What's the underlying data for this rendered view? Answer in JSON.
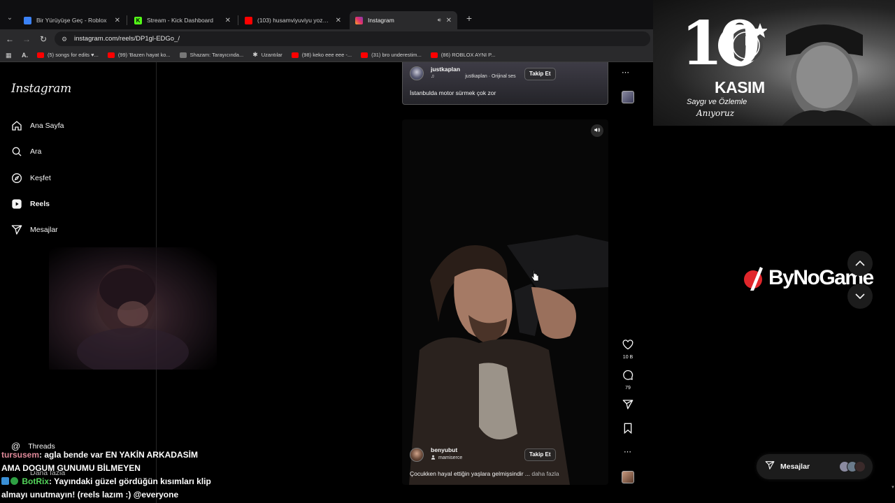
{
  "browser": {
    "tabs": [
      {
        "title": "Bir Yürüyüşe Geç - Roblox",
        "favicon_color": "#3b82f6",
        "active": false
      },
      {
        "title": "Stream - Kick Dashboard",
        "favicon_color": "#53fc18",
        "active": false
      },
      {
        "title": "(103) husamviyuviyu yozgat - Y",
        "favicon_color": "#ff0000",
        "active": false
      },
      {
        "title": "Instagram",
        "favicon_color": "#e1306c",
        "active": true
      }
    ],
    "url": "instagram.com/reels/DP1gl-EDGo_/",
    "bookmarks": [
      {
        "label": "(5) songs for edits ♥...",
        "color": "#ff0000"
      },
      {
        "label": "(99) 'Bazen hayat ko...",
        "color": "#ff0000"
      },
      {
        "label": "Shazam: Tarayıcında...",
        "color": "#888888"
      },
      {
        "label": "Uzantılar",
        "color": "#bbbbbb"
      },
      {
        "label": "(98) keko eee eee -...",
        "color": "#ff0000"
      },
      {
        "label": "(31) bro underestim...",
        "color": "#ff0000"
      },
      {
        "label": "(86) ROBLOX AYNI P...",
        "color": "#ff0000"
      }
    ]
  },
  "instagram": {
    "logo": "Instagram",
    "nav": [
      {
        "label": "Ana Sayfa",
        "icon": "home-icon"
      },
      {
        "label": "Ara",
        "icon": "search-icon"
      },
      {
        "label": "Keşfet",
        "icon": "compass-icon"
      },
      {
        "label": "Reels",
        "icon": "reels-icon"
      },
      {
        "label": "Mesajlar",
        "icon": "send-icon"
      }
    ],
    "threads_label": "Threads",
    "more_label": "Daha fazla",
    "reel_top": {
      "username": "justkaplan",
      "audio": "justkaplan · Orijinal ses",
      "follow": "Takip Et",
      "caption": "İstanbulda motor sürmek çok zor"
    },
    "reel_main": {
      "username": "benyubut",
      "audio": "mamiserce",
      "follow": "Takip Et",
      "caption": "Çocukken hayal ettiğin yaşlara gelmişsindir ...",
      "more": "daha fazla",
      "likes": "10 B",
      "comments": "79"
    },
    "messages_label": "Mesajlar"
  },
  "chat": [
    {
      "user": "tursusem",
      "text": ": agla bende var EN YAKİN ARKADASİM"
    },
    {
      "user": "",
      "text": "AMA DOGUM GUNUMU BİLMEYEN"
    },
    {
      "user": "BotRix",
      "text": ": Yayındaki güzel gördüğün kısımları klip"
    },
    {
      "user": "",
      "text": "almayı unutmayın! (reels lazım :) @everyone"
    }
  ],
  "overlay": {
    "banner_number": "10",
    "banner_month": "KASIM",
    "banner_line": "Saygı ve Özlemle",
    "banner_signature": "Anıyoruz",
    "sponsor": "ByNoGame"
  },
  "colors": {
    "ig_bg": "#000000",
    "chat_user": "#e08a9a",
    "bot_user": "#54d65b"
  }
}
